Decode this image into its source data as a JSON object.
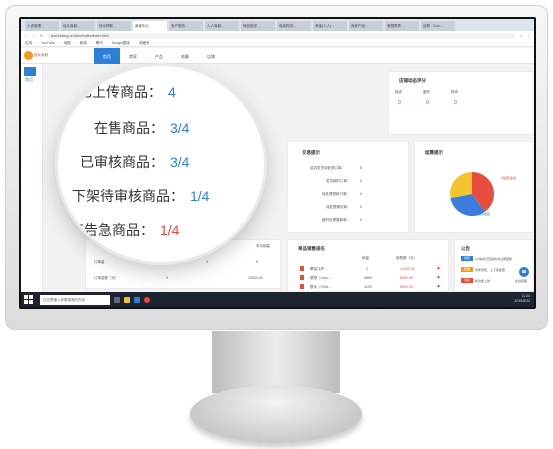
{
  "browser": {
    "tabs": [
      "人资管理…",
      "佰众商城…",
      "佰众物联…",
      "商家中心",
      "用户服务…",
      "人人商城…",
      "商品描述…",
      "电商物流…",
      "淘宝(人人)…",
      "商家产品…",
      "美图秀秀…",
      "谷歌 - Goo…"
    ],
    "url": "test.fublesp.cn/store/index/index.html",
    "bookmarks": [
      "应用",
      "YouTube",
      "地图",
      "新闻",
      "腾讯",
      "Google翻译",
      "收藏夹"
    ]
  },
  "app": {
    "logo_text": "佰众商城",
    "nav": [
      "首页",
      "商家",
      "产品",
      "结算",
      "店铺"
    ],
    "active_nav": "首页",
    "sidebar_label": "首页"
  },
  "store_rating": {
    "title": "店铺动态评分",
    "labels": [
      "描述",
      "服务",
      "物流"
    ],
    "values": [
      "0",
      "0",
      "0"
    ]
  },
  "trade_tips": {
    "title": "交易提示",
    "items": [
      {
        "label": "延迟发货待处理订单：",
        "value": "5"
      },
      {
        "label": "发货超时订单：",
        "value": "0"
      },
      {
        "label": "待处理退款订单：",
        "value": "0"
      },
      {
        "label": "待处理换货单：",
        "value": "0"
      },
      {
        "label": "超时处理退款单：",
        "value": "0"
      }
    ]
  },
  "settlement": {
    "title": "结算提示",
    "legend": [
      "待结算金额",
      "已结算金额"
    ]
  },
  "orders": {
    "column": "本月销量",
    "rows": [
      {
        "label": "订单量",
        "values": [
          "0",
          "5"
        ]
      },
      {
        "label": "订单金额（元）",
        "values": [
          "0",
          "20900.00"
        ]
      }
    ]
  },
  "sales_rank": {
    "title": "单品销售排名",
    "columns": [
      "销量",
      "销售额（元）"
    ],
    "rows": [
      {
        "name": "攀富沙护…",
        "qty": "2",
        "amount": "14750.00"
      },
      {
        "name": "联想（Leno…",
        "qty": "0809",
        "amount": "8050.00"
      },
      {
        "name": "联米（XGM…",
        "qty": "1109",
        "amount": "8050.00"
      }
    ]
  },
  "notices": {
    "title": "公告",
    "items": [
      {
        "tag": "通知",
        "text": "2.0版本已经发布请立即更新"
      },
      {
        "tag": "提醒",
        "text": "商家须知，上下架变更"
      },
      {
        "tag": "消息",
        "text": "新功能上线"
      }
    ]
  },
  "magnifier": {
    "rows": [
      {
        "label": "已上传商品：",
        "value": "4"
      },
      {
        "label": "在售商品：",
        "value": "3/4"
      },
      {
        "label": "已审核商品：",
        "value": "3/4"
      },
      {
        "label": "下架待审核商品：",
        "value": "1/4"
      },
      {
        "label": "库存告急商品：",
        "value": "1/4"
      }
    ]
  },
  "taskbar": {
    "search_placeholder": "在这里输入你要搜索的内容",
    "time": "11:24",
    "date": "2019/8/22"
  },
  "floating": {
    "label": "在线客服"
  },
  "chart_data": {
    "type": "pie",
    "title": "",
    "slices": [
      {
        "name": "待结算金额",
        "value": 40,
        "color": "#e74c3c"
      },
      {
        "name": "已结算金额",
        "value": 32,
        "color": "#3b7ddd"
      },
      {
        "name": "",
        "value": 28,
        "color": "#f4c330"
      }
    ]
  }
}
